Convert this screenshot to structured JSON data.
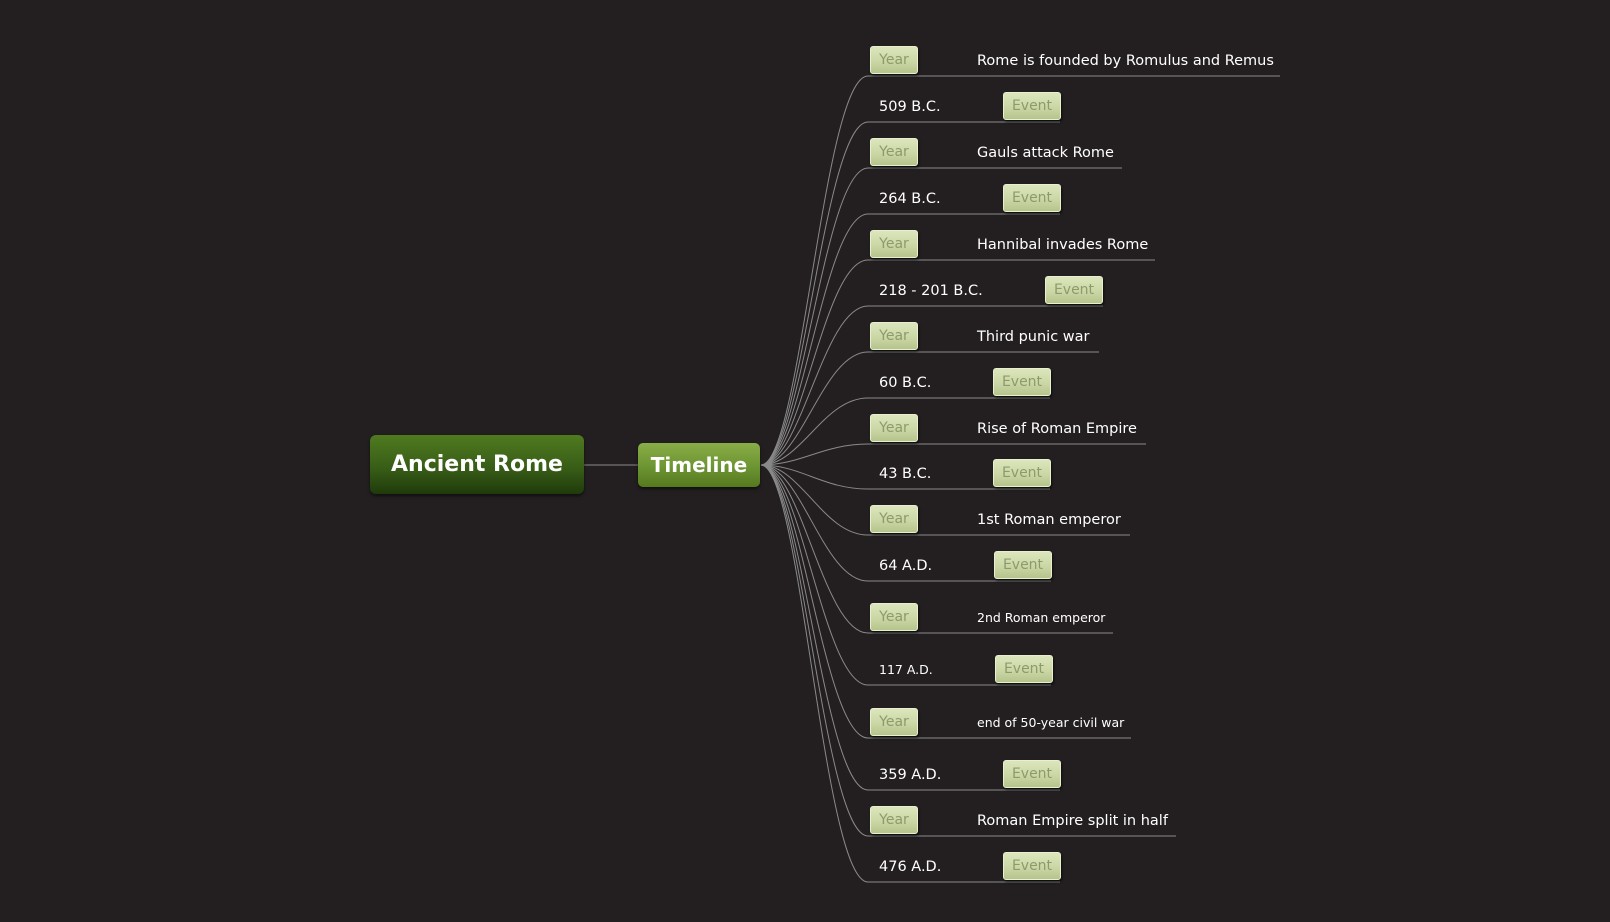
{
  "root": {
    "label": "Ancient Rome"
  },
  "branch": {
    "label": "Timeline"
  },
  "badges": {
    "year": "Year",
    "event": "Event"
  },
  "items": [
    {
      "text": "Rome is founded by Romulus and Remus",
      "badge": "Year"
    },
    {
      "text": "509 B.C.",
      "badge": "Event"
    },
    {
      "text": "Gauls attack Rome",
      "badge": "Year"
    },
    {
      "text": "264 B.C.",
      "badge": "Event"
    },
    {
      "text": "Hannibal invades Rome",
      "badge": "Year"
    },
    {
      "text": "218 - 201 B.C.",
      "badge": "Event"
    },
    {
      "text": "Third punic war",
      "badge": "Year"
    },
    {
      "text": "60 B.C.",
      "badge": "Event"
    },
    {
      "text": "Rise of Roman Empire",
      "badge": "Year"
    },
    {
      "text": "43 B.C.",
      "badge": "Event"
    },
    {
      "text": "1st Roman emperor",
      "badge": "Year"
    },
    {
      "text": "64 A.D.",
      "badge": "Event"
    },
    {
      "text": "2nd Roman emperor",
      "badge": "Year"
    },
    {
      "text": "117 A.D.",
      "badge": "Event"
    },
    {
      "text": "end of 50-year civil war",
      "badge": "Year"
    },
    {
      "text": "359 A.D.",
      "badge": "Event"
    },
    {
      "text": "Roman Empire split in half",
      "badge": "Year"
    },
    {
      "text": "476 A.D.",
      "badge": "Event"
    }
  ],
  "colors": {
    "background": "#231f20",
    "root_fill": "#375c17",
    "branch_fill": "#6c9432",
    "badge_fill": "#c9d6a3",
    "badge_text": "#8d9a6c",
    "connector": "#8a8a8a",
    "text": "#ffffff"
  }
}
